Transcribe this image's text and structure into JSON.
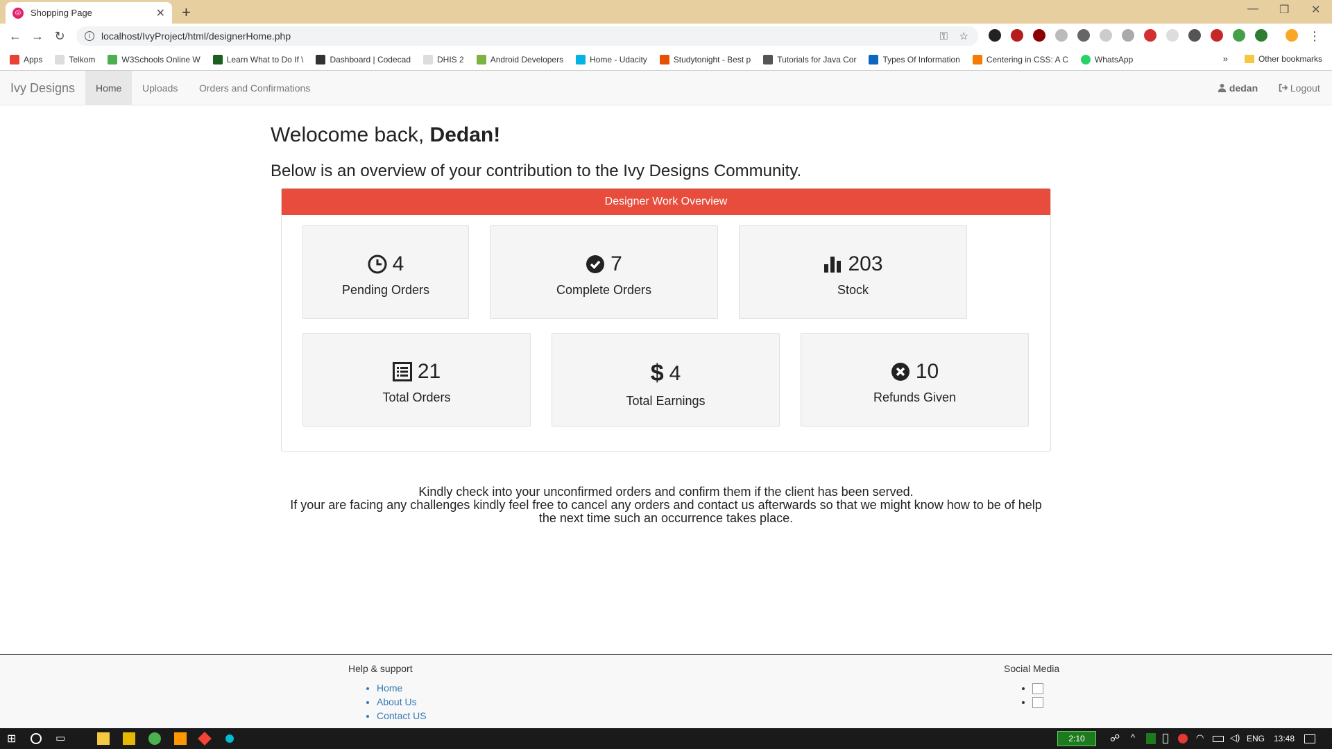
{
  "browser": {
    "tab_title": "Shopping Page",
    "url": "localhost/IvyProject/html/designerHome.php",
    "bookmarks": [
      {
        "label": "Apps",
        "color": "#e94235"
      },
      {
        "label": "Telkom",
        "color": "#999999"
      },
      {
        "label": "W3Schools Online W",
        "color": "#4caf50"
      },
      {
        "label": "Learn What to Do If \\",
        "color": "#1b5e20"
      },
      {
        "label": "Dashboard | Codecad",
        "color": "#333333"
      },
      {
        "label": "DHIS 2",
        "color": "#999999"
      },
      {
        "label": "Android Developers",
        "color": "#7cb342"
      },
      {
        "label": "Home - Udacity",
        "color": "#02b3e4"
      },
      {
        "label": "Studytonight - Best p",
        "color": "#e65100"
      },
      {
        "label": "Tutorials for Java Cor",
        "color": "#555555"
      },
      {
        "label": "Types Of Information",
        "color": "#0a66c2"
      },
      {
        "label": "Centering in CSS: A C",
        "color": "#f57c00"
      },
      {
        "label": "WhatsApp",
        "color": "#25d366"
      }
    ],
    "other_bookmarks": "Other bookmarks"
  },
  "nav": {
    "brand": "Ivy Designs",
    "items": [
      "Home",
      "Uploads",
      "Orders and Confirmations"
    ],
    "user": "dedan",
    "logout": "Logout"
  },
  "main": {
    "welcome_prefix": "Welocome back, ",
    "welcome_name": "Dedan!",
    "subtitle": "Below is an overview of your contribution to the Ivy Designs Community.",
    "panel_title": "Designer Work Overview",
    "cards": [
      {
        "value": "4",
        "label": "Pending Orders",
        "icon": "clock-icon"
      },
      {
        "value": "7",
        "label": "Complete Orders",
        "icon": "check-circle-icon"
      },
      {
        "value": "203",
        "label": "Stock",
        "icon": "bar-chart-icon"
      },
      {
        "value": "21",
        "label": "Total Orders",
        "icon": "list-icon"
      },
      {
        "value": "4",
        "label": "Total Earnings",
        "icon": "dollar-icon"
      },
      {
        "value": "10",
        "label": "Refunds Given",
        "icon": "x-circle-icon"
      }
    ],
    "notice_line1": "Kindly check into your unconfirmed orders and confirm them if the client has been served.",
    "notice_line2": "If your are facing any challenges kindly feel free to cancel any orders and contact us afterwards so that we might know how to be of help the next time such an occurrence takes place."
  },
  "footer": {
    "help_title": "Help & support",
    "help_links": [
      "Home",
      "About Us",
      "Contact US"
    ],
    "social_title": "Social Media"
  },
  "taskbar": {
    "battery": "2:10",
    "lang": "ENG",
    "time": "13:48"
  }
}
